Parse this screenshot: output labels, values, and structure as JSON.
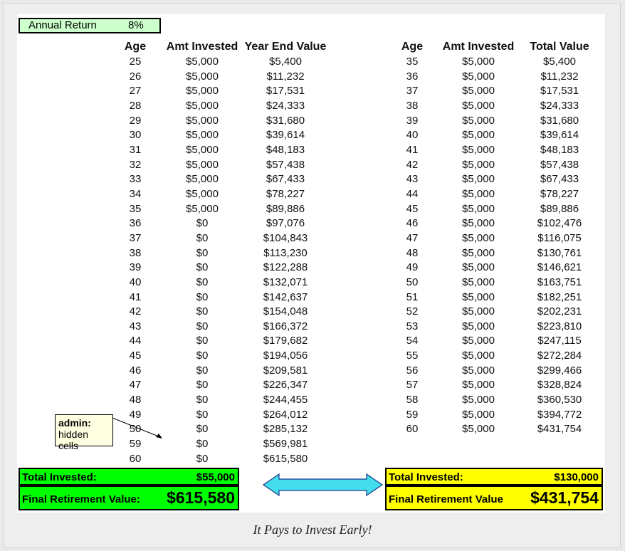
{
  "annual_return": {
    "label": "Annual Return",
    "value": "8%"
  },
  "left_table": {
    "headers": [
      "Age",
      "Amt Invested",
      "Year End Value"
    ],
    "ages": [
      "25",
      "26",
      "27",
      "28",
      "29",
      "30",
      "31",
      "32",
      "33",
      "34",
      "35",
      "36",
      "37",
      "38",
      "39",
      "40",
      "41",
      "42",
      "43",
      "44",
      "45",
      "46",
      "47",
      "48",
      "49",
      "50",
      "59",
      "60"
    ],
    "invested": [
      "$5,000",
      "$5,000",
      "$5,000",
      "$5,000",
      "$5,000",
      "$5,000",
      "$5,000",
      "$5,000",
      "$5,000",
      "$5,000",
      "$5,000",
      "$0",
      "$0",
      "$0",
      "$0",
      "$0",
      "$0",
      "$0",
      "$0",
      "$0",
      "$0",
      "$0",
      "$0",
      "$0",
      "$0",
      "$0",
      "$0",
      "$0"
    ],
    "values": [
      "$5,400",
      "$11,232",
      "$17,531",
      "$24,333",
      "$31,680",
      "$39,614",
      "$48,183",
      "$57,438",
      "$67,433",
      "$78,227",
      "$89,886",
      "$97,076",
      "$104,843",
      "$113,230",
      "$122,288",
      "$132,071",
      "$142,637",
      "$154,048",
      "$166,372",
      "$179,682",
      "$194,056",
      "$209,581",
      "$226,347",
      "$244,455",
      "$264,012",
      "$285,132",
      "$569,981",
      "$615,580"
    ]
  },
  "right_table": {
    "headers": [
      "Age",
      "Amt Invested",
      "Total Value"
    ],
    "ages": [
      "35",
      "36",
      "37",
      "38",
      "39",
      "40",
      "41",
      "42",
      "43",
      "44",
      "45",
      "46",
      "47",
      "48",
      "49",
      "50",
      "51",
      "52",
      "53",
      "54",
      "55",
      "56",
      "57",
      "58",
      "59",
      "60"
    ],
    "invested": [
      "$5,000",
      "$5,000",
      "$5,000",
      "$5,000",
      "$5,000",
      "$5,000",
      "$5,000",
      "$5,000",
      "$5,000",
      "$5,000",
      "$5,000",
      "$5,000",
      "$5,000",
      "$5,000",
      "$5,000",
      "$5,000",
      "$5,000",
      "$5,000",
      "$5,000",
      "$5,000",
      "$5,000",
      "$5,000",
      "$5,000",
      "$5,000",
      "$5,000",
      "$5,000"
    ],
    "values": [
      "$5,400",
      "$11,232",
      "$17,531",
      "$24,333",
      "$31,680",
      "$39,614",
      "$48,183",
      "$57,438",
      "$67,433",
      "$78,227",
      "$89,886",
      "$102,476",
      "$116,075",
      "$130,761",
      "$146,621",
      "$163,751",
      "$182,251",
      "$202,231",
      "$223,810",
      "$247,115",
      "$272,284",
      "$299,466",
      "$328,824",
      "$360,530",
      "$394,772",
      "$431,754"
    ]
  },
  "left_summary": {
    "total_label": "Total Invested:",
    "total_value": "$55,000",
    "final_label": "Final Retirement Value:",
    "final_value": "$615,580",
    "color": "#00ff00"
  },
  "right_summary": {
    "total_label": "Total Invested:",
    "total_value": "$130,000",
    "final_label": "Final Retirement Value",
    "final_value": "$431,754",
    "color": "#ffff00"
  },
  "comment": {
    "author": "admin:",
    "text": "hidden cells"
  },
  "arrow_color": "#44ddee",
  "caption": "It Pays to Invest Early!"
}
